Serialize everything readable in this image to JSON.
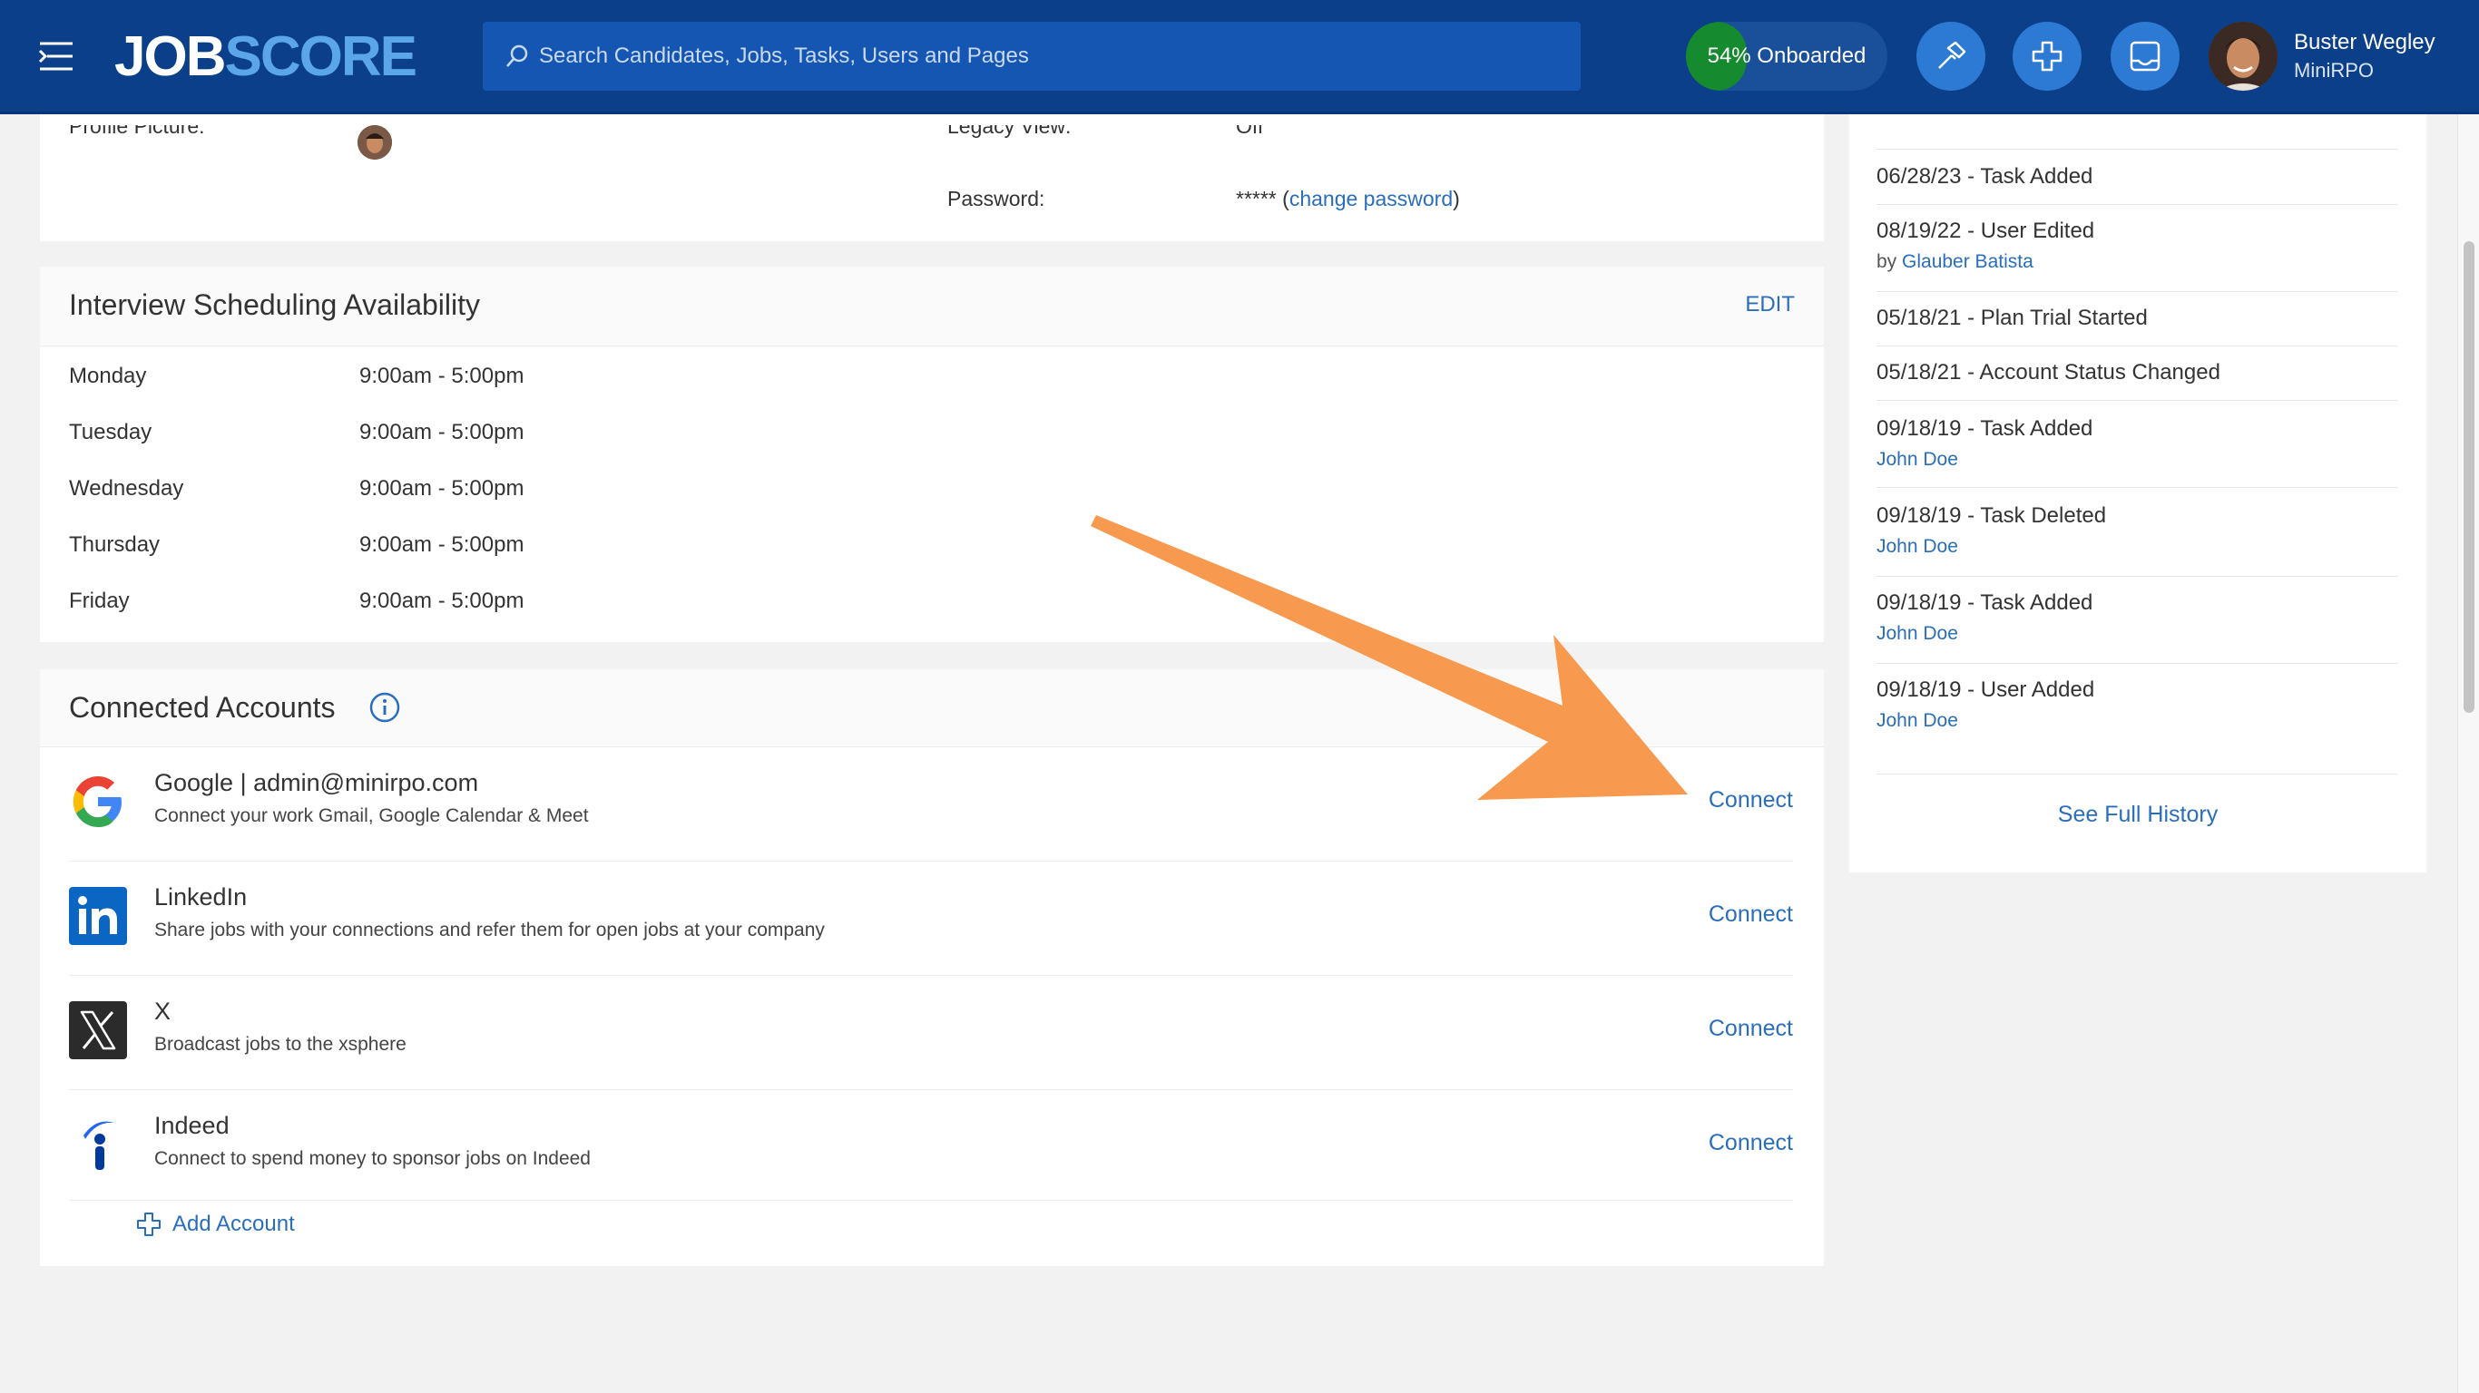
{
  "nav": {
    "logo_job": "JOB",
    "logo_score": "SCORE",
    "search_placeholder": "Search Candidates, Jobs, Tasks, Users and Pages",
    "onboarded_label": "54% Onboarded",
    "onboarded_progress": 0.3,
    "user_name": "Buster Wegley",
    "user_org": "MiniRPO"
  },
  "profile": {
    "profile_picture_label": "Profile Picture:",
    "legacy_view_label": "Legacy View:",
    "legacy_view_value": "Off",
    "password_label": "Password:",
    "password_value": "*****",
    "paren_open": "(",
    "change_password": "change password",
    "paren_close": ")"
  },
  "schedule": {
    "title": "Interview Scheduling Availability",
    "edit_label": "EDIT",
    "days": [
      {
        "day": "Monday",
        "hours": "9:00am - 5:00pm"
      },
      {
        "day": "Tuesday",
        "hours": "9:00am - 5:00pm"
      },
      {
        "day": "Wednesday",
        "hours": "9:00am - 5:00pm"
      },
      {
        "day": "Thursday",
        "hours": "9:00am - 5:00pm"
      },
      {
        "day": "Friday",
        "hours": "9:00am - 5:00pm"
      }
    ]
  },
  "accounts": {
    "title": "Connected Accounts",
    "items": [
      {
        "name": "Google | admin@minirpo.com",
        "desc": "Connect your work Gmail, Google Calendar & Meet",
        "action": "Connect",
        "icon": "google-icon"
      },
      {
        "name": "LinkedIn",
        "desc": "Share jobs with your connections and refer them for open jobs at your company",
        "action": "Connect",
        "icon": "linkedin-icon"
      },
      {
        "name": "X",
        "desc": "Broadcast jobs to the xsphere",
        "action": "Connect",
        "icon": "x-icon"
      },
      {
        "name": "Indeed",
        "desc": "Connect to spend money to sponsor jobs on Indeed",
        "action": "Connect",
        "icon": "indeed-icon"
      }
    ],
    "add_account": "Add Account"
  },
  "history": {
    "items": [
      {
        "title": "06/28/23 - Task Added",
        "sub": "",
        "sub_prefix": ""
      },
      {
        "title": "08/19/22 - User Edited",
        "sub_prefix": "by ",
        "sub": "Glauber Batista"
      },
      {
        "title": "05/18/21 - Plan Trial Started",
        "sub": "",
        "sub_prefix": ""
      },
      {
        "title": "05/18/21 - Account Status Changed",
        "sub": "",
        "sub_prefix": ""
      },
      {
        "title": "09/18/19 - Task Added",
        "sub_prefix": "",
        "sub": "John Doe"
      },
      {
        "title": "09/18/19 - Task Deleted",
        "sub_prefix": "",
        "sub": "John Doe"
      },
      {
        "title": "09/18/19 - Task Added",
        "sub_prefix": "",
        "sub": "John Doe"
      },
      {
        "title": "09/18/19 - User Added",
        "sub_prefix": "",
        "sub": "John Doe"
      }
    ],
    "see_full_history": "See Full History"
  },
  "colors": {
    "nav_bg": "#0b3f8a",
    "link": "#2a6ebb",
    "arrow": "#f79a4f",
    "onboard_fill": "#168a2e"
  }
}
